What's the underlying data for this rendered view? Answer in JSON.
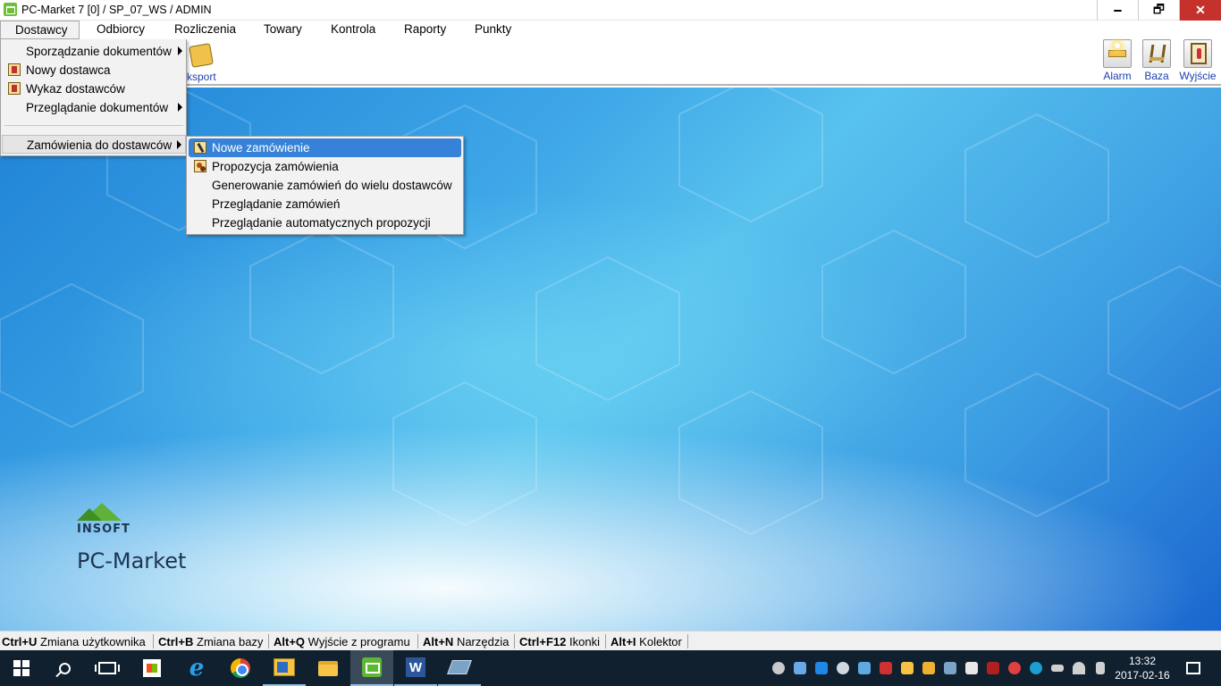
{
  "window": {
    "title": "PC-Market 7 [0] / SP_07_WS / ADMIN",
    "minimize": "🗕",
    "restore": "🗗",
    "close": "✕"
  },
  "menubar": {
    "items": [
      "Dostawcy",
      "Odbiorcy",
      "Rozliczenia",
      "Towary",
      "Kontrola",
      "Raporty",
      "Punkty"
    ]
  },
  "toolbar": {
    "eksport_label": "ksport",
    "alarm_label": "Alarm",
    "baza_label": "Baza",
    "exit_label": "Wyjście"
  },
  "dostawcy_menu": {
    "items": [
      {
        "label": "Sporządzanie dokumentów",
        "submenu": true
      },
      {
        "label": "Nowy dostawca",
        "icon": "supplier-new-icon"
      },
      {
        "label": "Wykaz dostawców",
        "icon": "supplier-list-icon"
      },
      {
        "label": "Przeglądanie dokumentów",
        "submenu": true
      },
      {
        "label": "Zamówienia do dostawców",
        "submenu": true
      }
    ]
  },
  "zamowienia_submenu": {
    "items": [
      {
        "label": "Nowe zamówienie",
        "icon": "pen-icon",
        "selected": true
      },
      {
        "label": "Propozycja zamówienia",
        "icon": "gears-icon"
      },
      {
        "label": "Generowanie zamówień do wielu dostawców"
      },
      {
        "label": "Przeglądanie zamówień"
      },
      {
        "label": "Przeglądanie automatycznych propozycji"
      }
    ]
  },
  "logo": {
    "company": "INSOFT",
    "product": "PC-Market"
  },
  "statusbar": {
    "shortcuts": [
      {
        "key": "Ctrl+U",
        "label": "Zmiana użytkownika"
      },
      {
        "key": "Ctrl+B",
        "label": "Zmiana bazy"
      },
      {
        "key": "Alt+Q",
        "label": "Wyjście z programu"
      },
      {
        "key": "Alt+N",
        "label": "Narzędzia"
      },
      {
        "key": "Ctrl+F12",
        "label": "Ikonki"
      },
      {
        "key": "Alt+I",
        "label": "Kolektor"
      }
    ]
  },
  "taskbar": {
    "ie_letter": "e",
    "word_letter": "W",
    "clock_time": "13:32",
    "clock_date": "2017-02-16"
  },
  "colors": {
    "selection": "#3582d8",
    "accent_link": "#1d3fae",
    "close_button": "#c4322b",
    "taskbar": "#10202f"
  }
}
